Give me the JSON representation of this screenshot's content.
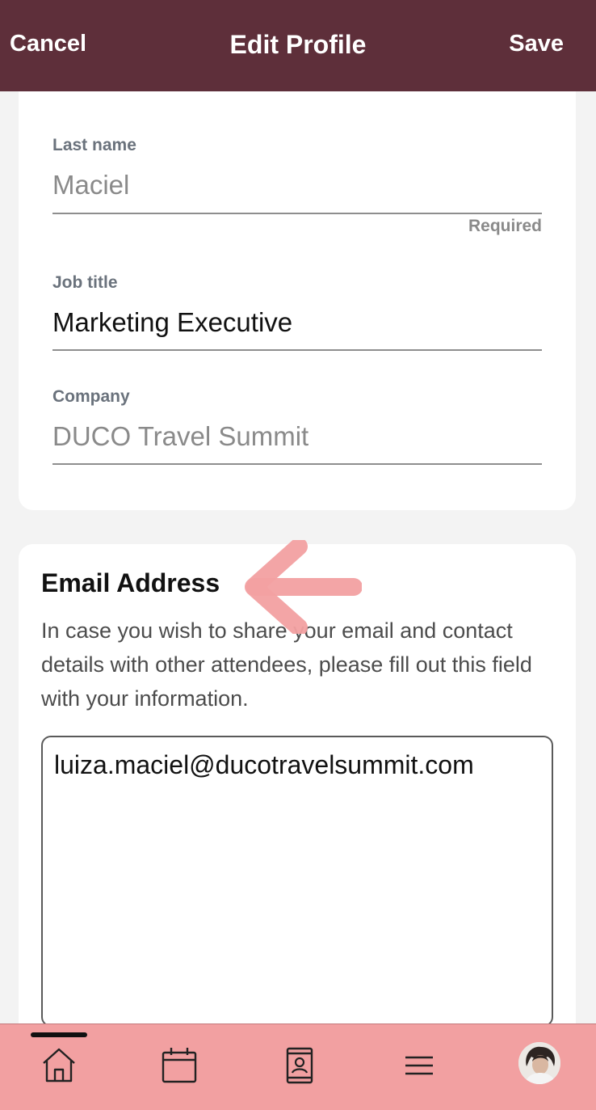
{
  "header": {
    "cancel_label": "Cancel",
    "title": "Edit Profile",
    "save_label": "Save"
  },
  "profile": {
    "last_name": {
      "label": "Last name",
      "value": "Maciel",
      "helper": "Required"
    },
    "job_title": {
      "label": "Job title",
      "value": "Marketing Executive"
    },
    "company": {
      "label": "Company",
      "value": "DUCO Travel Summit"
    }
  },
  "email_section": {
    "title": "Email Address",
    "description": "In case you wish to share your email and contact details with other attendees, please fill out this field with your information.",
    "value": "luiza.maciel@ducotravelsummit.com"
  },
  "tabbar": {
    "items": [
      {
        "name": "home",
        "icon": "home-icon",
        "active": true
      },
      {
        "name": "calendar",
        "icon": "calendar-icon"
      },
      {
        "name": "contacts",
        "icon": "contact-book-icon"
      },
      {
        "name": "menu",
        "icon": "hamburger-menu-icon"
      },
      {
        "name": "profile",
        "icon": "avatar"
      }
    ]
  },
  "colors": {
    "header_bg": "#5e2f3a",
    "tabbar_bg": "#f2a0a1",
    "annotation_arrow": "#f2a0a1"
  }
}
